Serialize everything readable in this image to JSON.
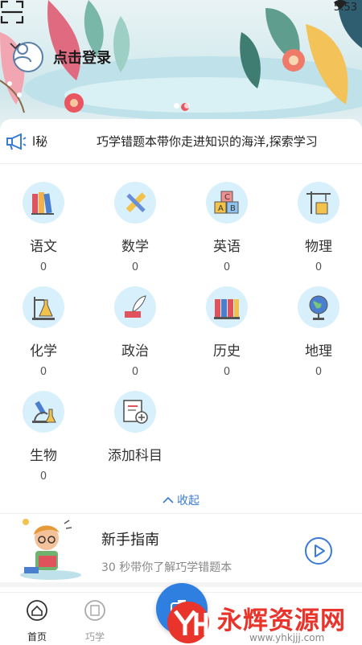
{
  "status_bar": {
    "time": "5:53"
  },
  "header": {
    "login_label": "点击登录"
  },
  "notice": {
    "tail": "l秘",
    "text": "巧学错题本带你走进知识的海洋,探索学习"
  },
  "subjects": [
    {
      "name": "语文",
      "count": "0",
      "icon": "books-icon"
    },
    {
      "name": "数学",
      "count": "0",
      "icon": "ruler-pencil-icon"
    },
    {
      "name": "英语",
      "count": "0",
      "icon": "abc-blocks-icon"
    },
    {
      "name": "物理",
      "count": "0",
      "icon": "crane-icon"
    },
    {
      "name": "化学",
      "count": "0",
      "icon": "flask-icon"
    },
    {
      "name": "政治",
      "count": "0",
      "icon": "quill-icon"
    },
    {
      "name": "历史",
      "count": "0",
      "icon": "history-books-icon"
    },
    {
      "name": "地理",
      "count": "0",
      "icon": "globe-icon"
    },
    {
      "name": "生物",
      "count": "0",
      "icon": "microscope-icon"
    }
  ],
  "add_subject": {
    "label": "添加科目",
    "icon": "add-book-icon"
  },
  "collapse_label": "收起",
  "guide": {
    "title": "新手指南",
    "subtitle": "30 秒带你了解巧学错题本"
  },
  "bottom_nav": {
    "home_label": "首页",
    "study_label": "巧学"
  },
  "watermark": {
    "brand": "永辉资源网",
    "url": "www.yhkjjj.com"
  },
  "colors": {
    "accent": "#3a7bd5",
    "icon_circle": "#d8f0fb",
    "watermark_red": "#e8342a"
  }
}
